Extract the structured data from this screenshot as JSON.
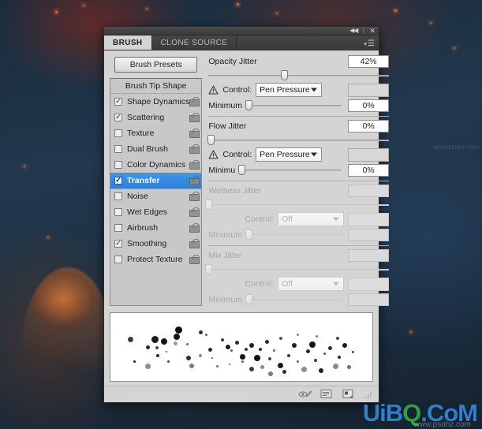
{
  "window": {
    "collapse_icon": "collapse-icon",
    "close_icon": "close-icon",
    "menu_icon": "panel-menu-icon"
  },
  "tabs": [
    {
      "label": "BRUSH",
      "active": true
    },
    {
      "label": "CLONE SOURCE",
      "active": false
    }
  ],
  "sidebar": {
    "presets_button": "Brush Presets",
    "header": "Brush Tip Shape",
    "items": [
      {
        "label": "Shape Dynamics",
        "checked": true,
        "selected": false,
        "divider": false
      },
      {
        "label": "Scattering",
        "checked": true,
        "selected": false,
        "divider": false
      },
      {
        "label": "Texture",
        "checked": false,
        "selected": false,
        "divider": false
      },
      {
        "label": "Dual Brush",
        "checked": false,
        "selected": false,
        "divider": false
      },
      {
        "label": "Color Dynamics",
        "checked": false,
        "selected": false,
        "divider": false
      },
      {
        "label": "Transfer",
        "checked": true,
        "selected": true,
        "divider": false
      },
      {
        "label": "Noise",
        "checked": false,
        "selected": false,
        "divider": true
      },
      {
        "label": "Wet Edges",
        "checked": false,
        "selected": false,
        "divider": false
      },
      {
        "label": "Airbrush",
        "checked": false,
        "selected": false,
        "divider": false
      },
      {
        "label": "Smoothing",
        "checked": true,
        "selected": false,
        "divider": false
      },
      {
        "label": "Protect Texture",
        "checked": false,
        "selected": false,
        "divider": false
      }
    ],
    "lock_icon": "unlocked-padlock-icon"
  },
  "controls": {
    "control_label": "Control:",
    "minimum_label": "Minimum",
    "minimum_label_clipped": "Minimu",
    "warning_icon": "warning-triangle-icon",
    "sections": [
      {
        "name": "opacity-jitter",
        "title": "Opacity Jitter",
        "value": "42%",
        "slider_pct": 42,
        "enabled": true,
        "has_warning": true,
        "control_value": "Pen Pressure",
        "minimum_value": "0%",
        "minimum_pct": 3
      },
      {
        "name": "flow-jitter",
        "title": "Flow Jitter",
        "value": "0%",
        "slider_pct": 1,
        "enabled": true,
        "has_warning": true,
        "control_value": "Pen Pressure",
        "minimum_value": "0%",
        "minimum_pct": 3
      },
      {
        "name": "wetness-jitter",
        "title": "Wetness Jitter",
        "value": "",
        "slider_pct": 0,
        "enabled": false,
        "has_warning": false,
        "control_value": "Off",
        "minimum_value": "",
        "minimum_pct": 3
      },
      {
        "name": "mix-jitter",
        "title": "Mix Jitter",
        "value": "",
        "slider_pct": 0,
        "enabled": false,
        "has_warning": false,
        "control_value": "Off",
        "minimum_value": "",
        "minimum_pct": 3
      }
    ]
  },
  "preview": {
    "name": "brush-stroke-preview",
    "dots": [
      [
        22,
        22,
        7,
        "#3a3a3a"
      ],
      [
        45,
        33,
        5,
        "#2b2b2b"
      ],
      [
        52,
        21,
        9,
        "#1a1a1a"
      ],
      [
        64,
        24,
        8,
        "#121212"
      ],
      [
        57,
        34,
        4,
        "#4a4a4a"
      ],
      [
        80,
        28,
        5,
        "#9a9a9a"
      ],
      [
        96,
        30,
        3,
        "#6b6b6b"
      ],
      [
        112,
        14,
        5,
        "#2f2f2f"
      ],
      [
        80,
        18,
        8,
        "#141414"
      ],
      [
        58,
        44,
        4,
        "#2a2a2a"
      ],
      [
        70,
        40,
        2,
        "#555"
      ],
      [
        82,
        9,
        9,
        "#0d0d0d"
      ],
      [
        96,
        46,
        6,
        "#333"
      ],
      [
        29,
        52,
        3,
        "#1f1f1f"
      ],
      [
        44,
        56,
        7,
        "#8e8e8e"
      ],
      [
        72,
        52,
        3,
        "#444"
      ],
      [
        100,
        56,
        6,
        "#7e7e7e"
      ],
      [
        120,
        18,
        3,
        "#6a6a6a"
      ],
      [
        124,
        36,
        5,
        "#2d2d2d"
      ],
      [
        128,
        48,
        2,
        "#555"
      ],
      [
        140,
        24,
        4,
        "#3b3b3b"
      ],
      [
        146,
        32,
        6,
        "#1c1c1c"
      ],
      [
        152,
        38,
        3,
        "#5c5c5c"
      ],
      [
        158,
        27,
        5,
        "#2a2a2a"
      ],
      [
        164,
        44,
        7,
        "#141414"
      ],
      [
        170,
        36,
        4,
        "#3a3a3a"
      ],
      [
        176,
        30,
        6,
        "#1e1e1e"
      ],
      [
        166,
        52,
        3,
        "#666"
      ],
      [
        182,
        45,
        8,
        "#0f0f0f"
      ],
      [
        188,
        36,
        4,
        "#2e2e2e"
      ],
      [
        176,
        60,
        6,
        "#3a3a3a"
      ],
      [
        190,
        58,
        5,
        "#8a8a8a"
      ],
      [
        196,
        26,
        5,
        "#2a2a2a"
      ],
      [
        200,
        48,
        4,
        "#444"
      ],
      [
        206,
        38,
        3,
        "#6f6f6f"
      ],
      [
        212,
        55,
        7,
        "#1a1a1a"
      ],
      [
        200,
        66,
        6,
        "#7a7a7a"
      ],
      [
        218,
        64,
        5,
        "#2c2c2c"
      ],
      [
        224,
        44,
        4,
        "#3c3c3c"
      ],
      [
        230,
        30,
        6,
        "#202020"
      ],
      [
        236,
        52,
        3,
        "#666"
      ],
      [
        242,
        60,
        7,
        "#8b8b8b"
      ],
      [
        248,
        38,
        5,
        "#2a2a2a"
      ],
      [
        252,
        28,
        8,
        "#161616"
      ],
      [
        258,
        50,
        4,
        "#3f3f3f"
      ],
      [
        264,
        62,
        6,
        "#1d1d1d"
      ],
      [
        270,
        42,
        3,
        "#5a5a5a"
      ],
      [
        276,
        34,
        5,
        "#303030"
      ],
      [
        282,
        56,
        7,
        "#888"
      ],
      [
        288,
        46,
        4,
        "#2b2b2b"
      ],
      [
        294,
        30,
        6,
        "#1b1b1b"
      ],
      [
        300,
        58,
        5,
        "#6e6e6e"
      ],
      [
        306,
        40,
        3,
        "#4a4a4a"
      ],
      [
        112,
        44,
        4,
        "#8a8a8a"
      ],
      [
        134,
        58,
        3,
        "#777"
      ],
      [
        150,
        56,
        2,
        "#555"
      ],
      [
        214,
        22,
        4,
        "#555"
      ],
      [
        236,
        18,
        3,
        "#888"
      ],
      [
        260,
        20,
        3,
        "#777"
      ],
      [
        286,
        22,
        4,
        "#4a4a4a"
      ]
    ]
  },
  "toolbar": {
    "icons": [
      {
        "name": "toggle-brush-preview-icon"
      },
      {
        "name": "open-preset-manager-icon"
      },
      {
        "name": "create-new-brush-icon"
      },
      {
        "name": "resize-grip-icon"
      }
    ]
  },
  "watermark": {
    "main_prefix": "UiB",
    "main_mid": "Q",
    "main_suffix": ".CoM",
    "sub": "www.psahz.com",
    "side": "www.psahz.com"
  }
}
